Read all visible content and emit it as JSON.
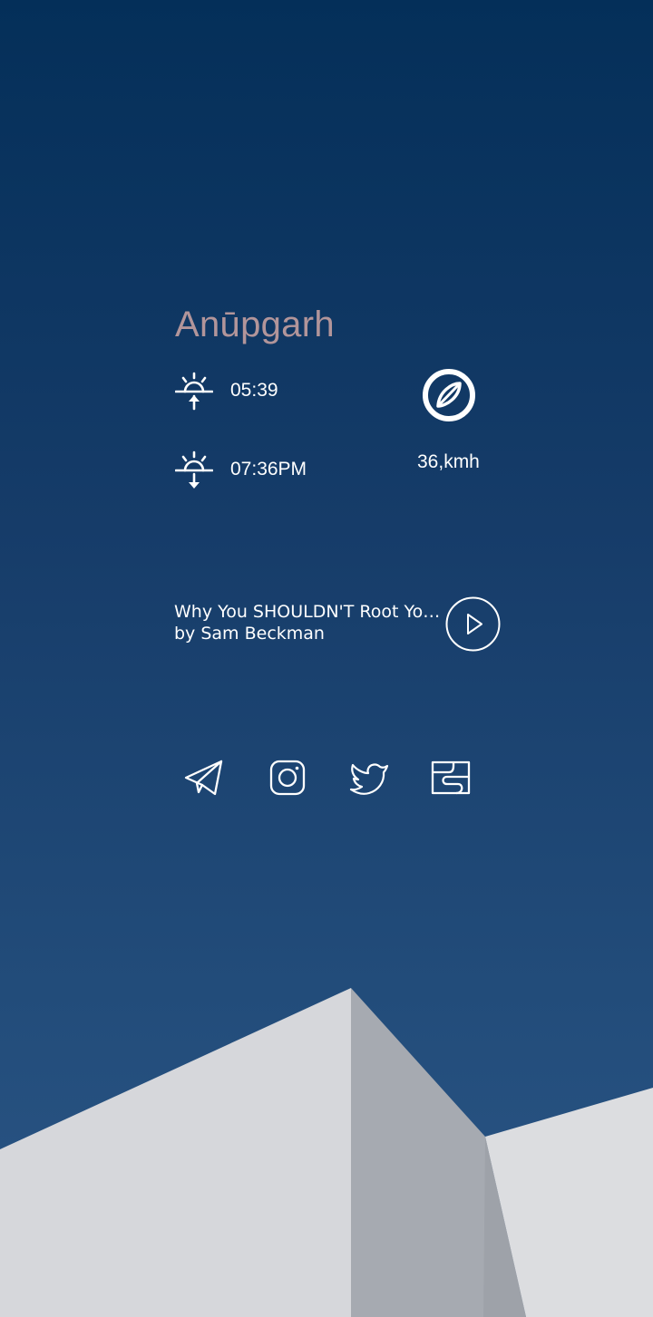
{
  "weather": {
    "city": "Anūpgarh",
    "sunrise": "05:39",
    "sunset": "07:36PM",
    "wind": "36,kmh"
  },
  "media": {
    "title": "Why You SHOULDN'T Root Your P...",
    "artist": "by Sam Beckman"
  },
  "icons": {
    "sunrise": "sunrise-icon",
    "sunset": "sunset-icon",
    "compass": "compass-icon",
    "play": "play-icon",
    "social": [
      "telegram-icon",
      "instagram-icon",
      "twitter-icon",
      "wallet-icon"
    ]
  },
  "colors": {
    "city": "#b2959a",
    "building_light": "#d6d7db",
    "building_shadow": "#a6aab1"
  }
}
